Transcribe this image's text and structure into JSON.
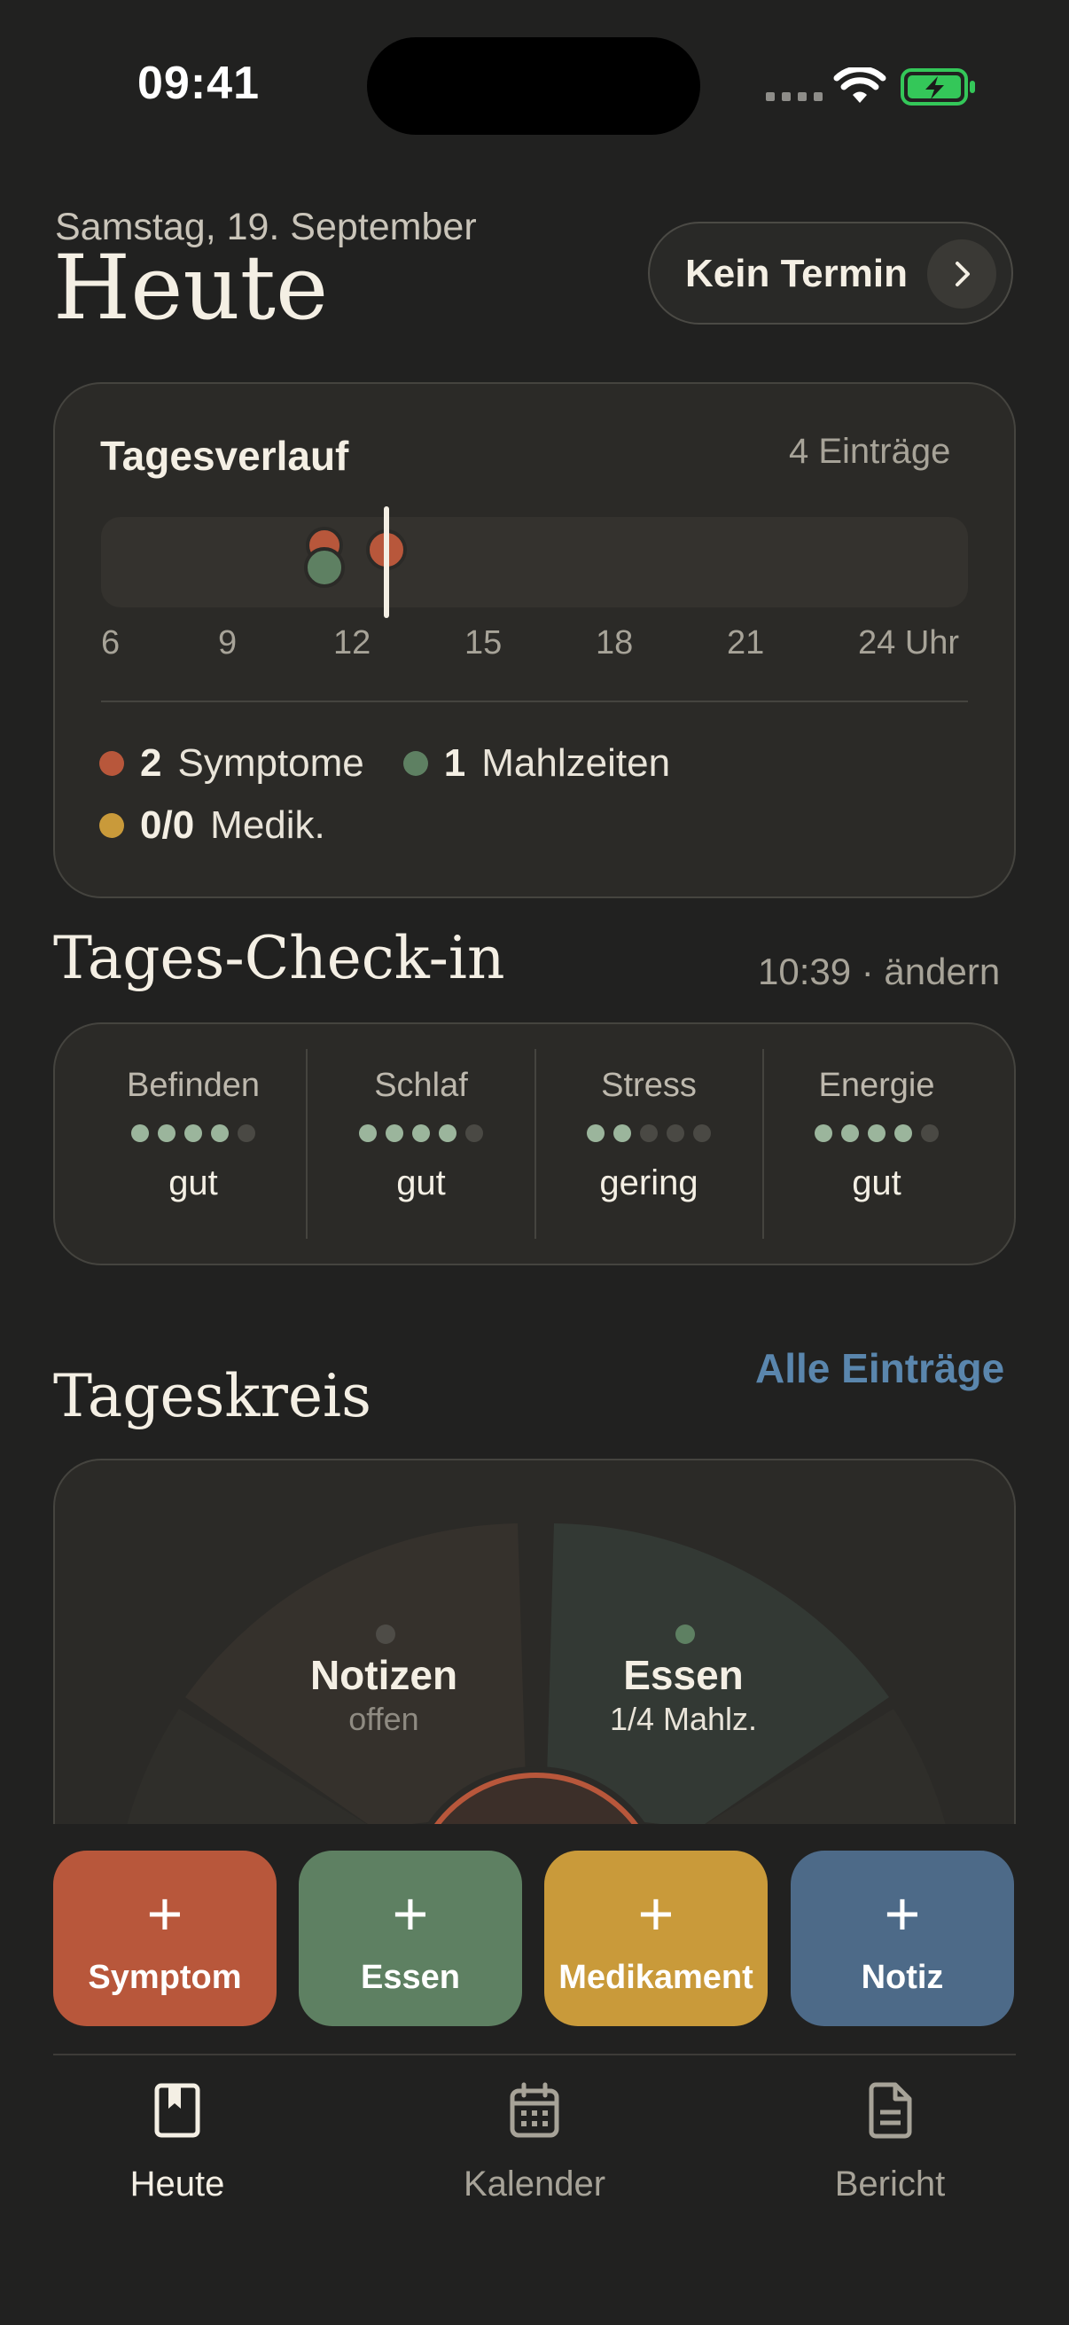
{
  "status_bar": {
    "time": "09:41"
  },
  "header": {
    "date": "Samstag, 19. September",
    "title": "Heute",
    "appointment_button": "Kein Termin"
  },
  "tagesverlauf": {
    "title": "Tagesverlauf",
    "count": "4 Einträge",
    "ticks": [
      "6",
      "9",
      "12",
      "15",
      "18",
      "21",
      "24 Uhr"
    ],
    "legend": {
      "symptoms_count": "2",
      "symptoms_label": "Symptome",
      "meals_count": "1",
      "meals_label": "Mahlzeiten",
      "meds_count": "0/0",
      "meds_label": "Medik."
    }
  },
  "checkin": {
    "title": "Tages-Check-in",
    "meta": "10:39 · ändern",
    "items": [
      {
        "label": "Befinden",
        "level": 4,
        "value": "gut"
      },
      {
        "label": "Schlaf",
        "level": 4,
        "value": "gut"
      },
      {
        "label": "Stress",
        "level": 2,
        "value": "gering"
      },
      {
        "label": "Energie",
        "level": 4,
        "value": "gut"
      }
    ]
  },
  "tageskreis": {
    "title": "Tageskreis",
    "link": "Alle Einträge",
    "segments": [
      {
        "label": "Notizen",
        "sub": "offen"
      },
      {
        "label": "Essen",
        "sub": "1/4 Mahlz."
      }
    ]
  },
  "actions": [
    {
      "plus": "+",
      "label": "Symptom"
    },
    {
      "plus": "+",
      "label": "Essen"
    },
    {
      "plus": "+",
      "label": "Medikament"
    },
    {
      "plus": "+",
      "label": "Notiz"
    }
  ],
  "tabs": [
    {
      "label": "Heute",
      "icon": "bookmark-book-icon",
      "active": true
    },
    {
      "label": "Kalender",
      "icon": "calendar-icon",
      "active": false
    },
    {
      "label": "Bericht",
      "icon": "document-icon",
      "active": false
    }
  ],
  "colors": {
    "symptom": "#b8573b",
    "meal": "#5e8062",
    "medication": "#c99a3a",
    "note": "#4d6a88",
    "link": "#5a86ad",
    "background": "#212120"
  }
}
